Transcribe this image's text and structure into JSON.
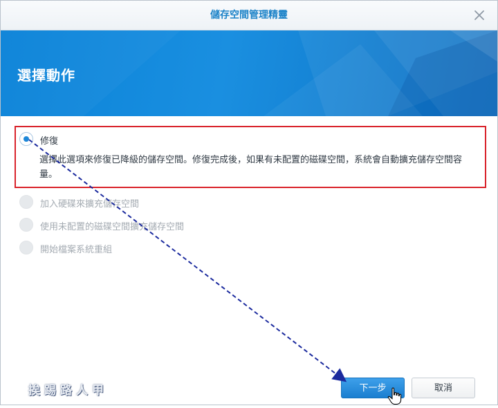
{
  "window": {
    "title": "儲存空間管理精靈"
  },
  "banner": {
    "heading": "選擇動作"
  },
  "options": [
    {
      "label": "修復",
      "selected": true,
      "enabled": true,
      "description": "選擇此選項來修復已降級的儲存空間。修復完成後，如果有未配置的磁碟空間，系統會自動擴充儲存空間容量。"
    },
    {
      "label": "加入硬碟來擴充儲存空間",
      "selected": false,
      "enabled": false
    },
    {
      "label": "使用未配置的磁碟空間擴充儲存空間",
      "selected": false,
      "enabled": false
    },
    {
      "label": "開始檔案系統重組",
      "selected": false,
      "enabled": false
    }
  ],
  "buttons": {
    "next_label": "下一步",
    "cancel_label": "取消"
  },
  "watermark": "挨踢路人甲",
  "colors": {
    "accent": "#1d87d8",
    "highlight_border": "#d9222a",
    "annotation_arrow": "#1b2a9e"
  }
}
